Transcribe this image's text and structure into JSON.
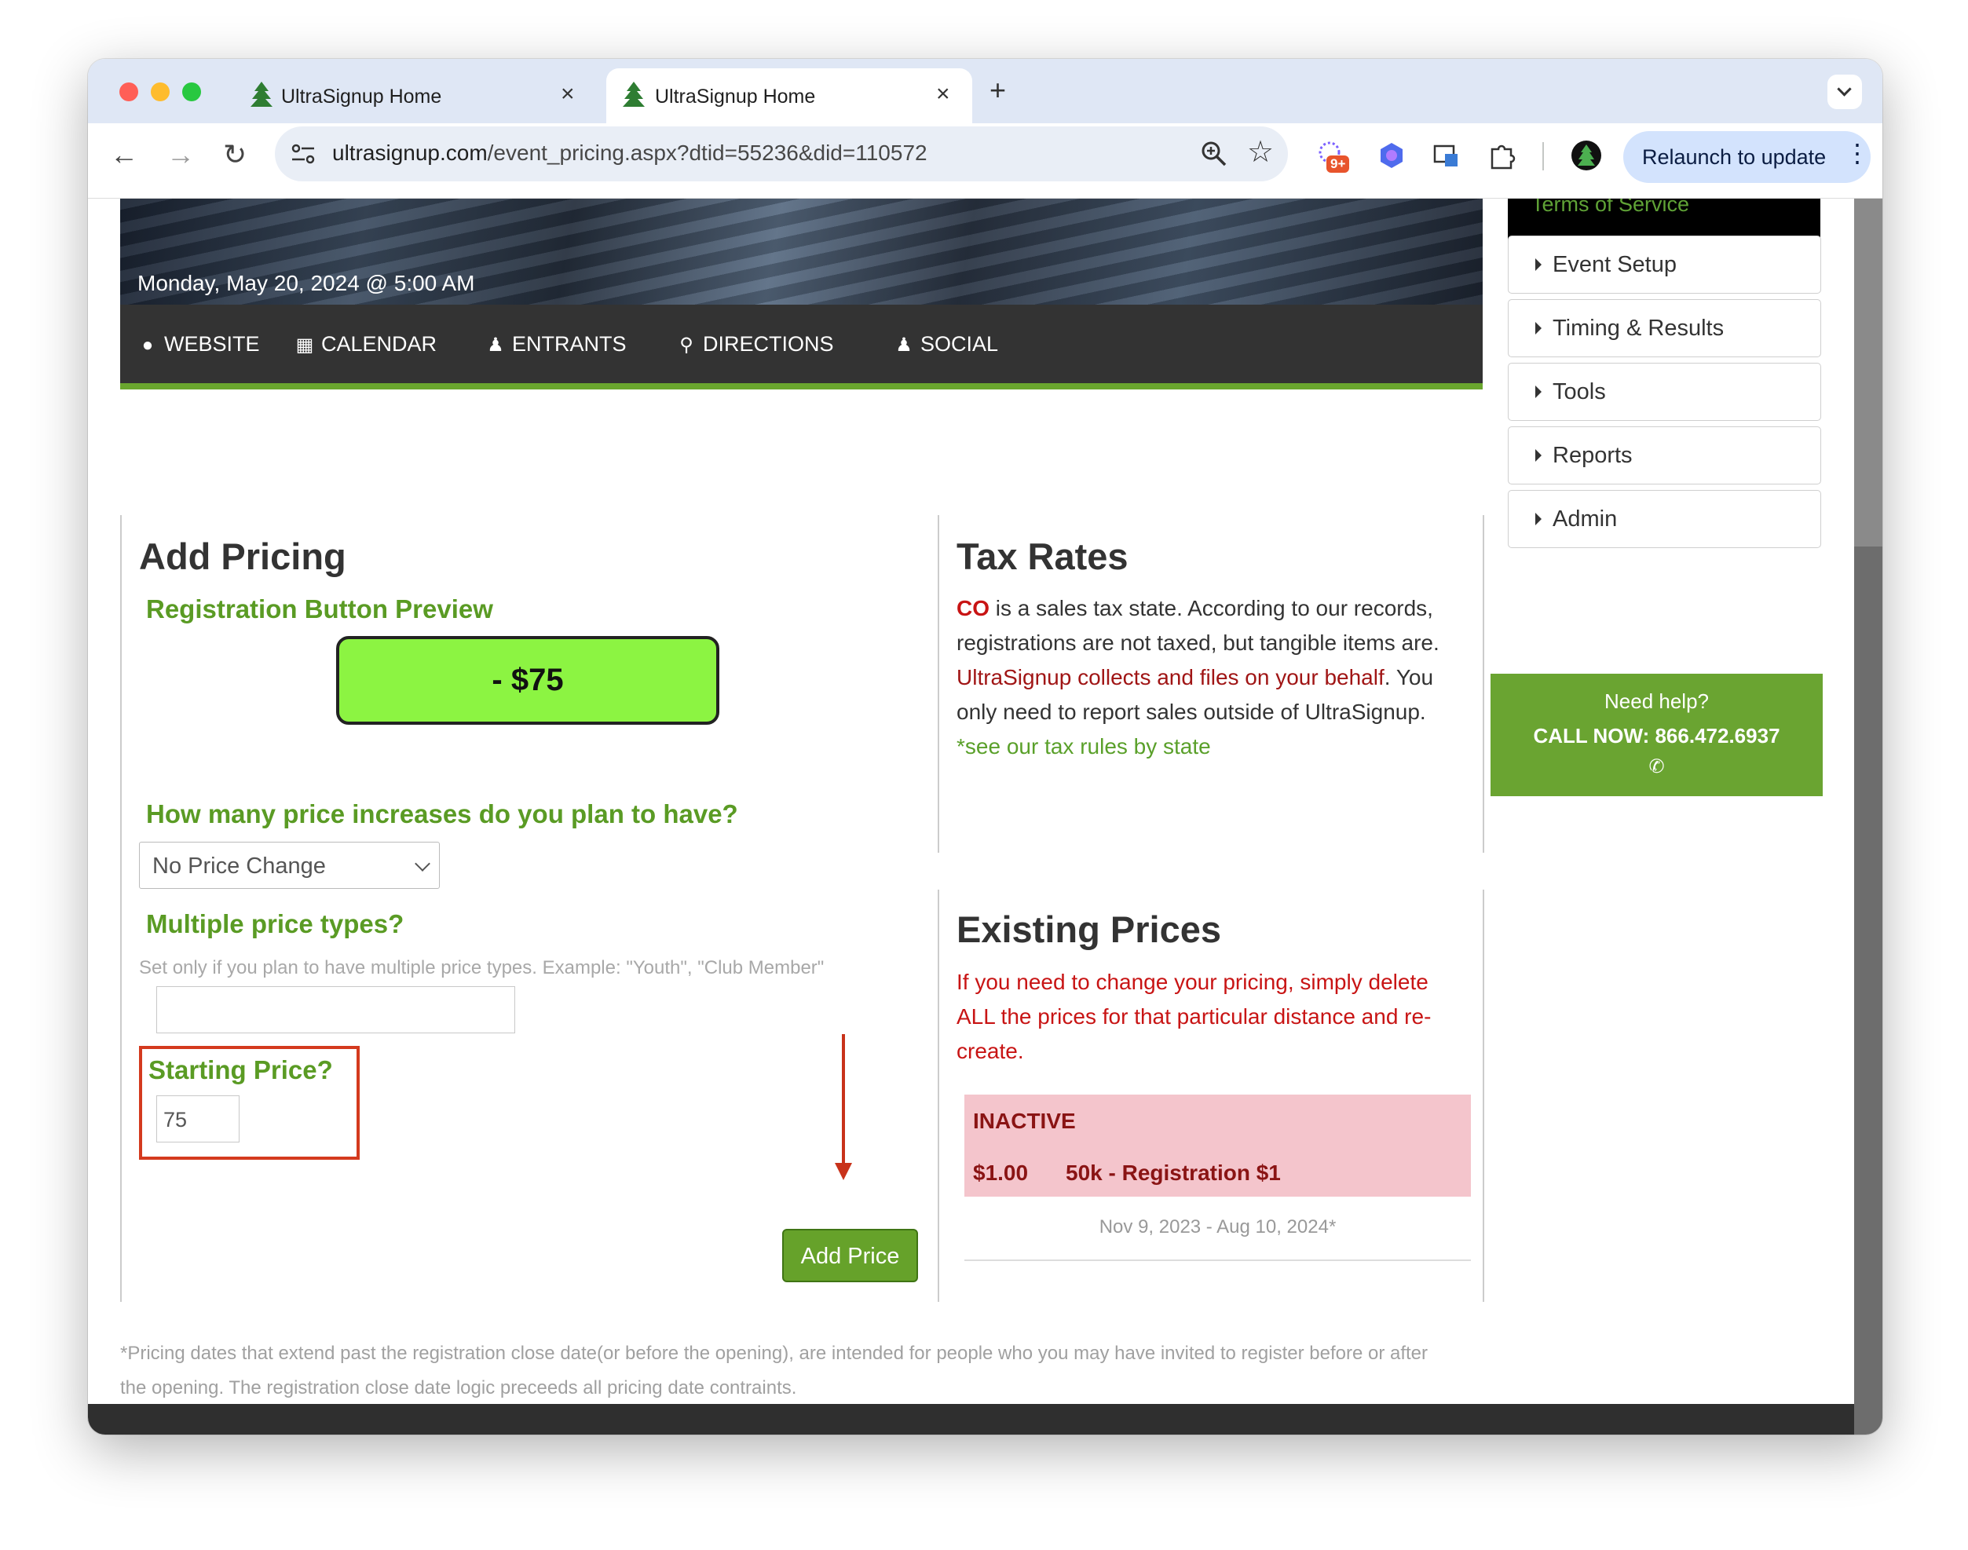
{
  "browser": {
    "tabs": [
      {
        "title": "UltraSignup Home",
        "active": false
      },
      {
        "title": "UltraSignup Home",
        "active": true
      }
    ],
    "url_host": "ultrasignup.com",
    "url_path": "/event_pricing.aspx?dtid=55236&did=110572",
    "extension_badge": "9+",
    "relaunch_label": "Relaunch to update"
  },
  "event": {
    "date": "Monday, May 20, 2024 @ 5:00 AM",
    "nav": [
      "WEBSITE",
      "CALENDAR",
      "ENTRANTS",
      "DIRECTIONS",
      "SOCIAL"
    ]
  },
  "sidebar": {
    "tos": "Terms of Service",
    "items": [
      "Event Setup",
      "Timing & Results",
      "Tools",
      "Reports",
      "Admin"
    ],
    "help": {
      "line1": "Need help?",
      "line2": "CALL NOW: 866.472.6937"
    }
  },
  "add_pricing": {
    "title": "Add Pricing",
    "preview_heading": "Registration Button Preview",
    "preview_button": "- $75",
    "increases_question": "How many price increases do you plan to have?",
    "increases_selected": "No Price Change",
    "types_question": "Multiple price types?",
    "types_hint": "Set only if you plan to have multiple price types. Example: \"Youth\", \"Club Member\"",
    "types_value": "",
    "starting_label": "Starting Price?",
    "starting_value": "75",
    "add_button": "Add Price"
  },
  "tax": {
    "title": "Tax Rates",
    "state": "CO",
    "line1_rest": " is a sales tax state. According to our records,",
    "line2": "registrations are not taxed, but tangible items are.",
    "line3_red": "UltraSignup collects and files on your behalf",
    "line3_rest": ". You",
    "line4": "only need to report sales outside of UltraSignup.",
    "link": "*see our tax rules by state"
  },
  "existing": {
    "title": "Existing Prices",
    "notice": [
      "If you need to change your pricing, simply delete",
      "ALL the prices for that particular distance and re-",
      "create."
    ],
    "status": "INACTIVE",
    "amount": "$1.00",
    "name": "50k - Registration $1",
    "range": "Nov 9, 2023 - Aug 10, 2024*"
  },
  "footnote": [
    "*Pricing dates that extend past the registration close date(or before the opening), are intended for people who you may have invited to register before or after",
    "the opening. The registration close date logic preceeds all pricing date contraints."
  ],
  "colors": {
    "accent_green": "#5a9b24",
    "preview_button": "#8cf442",
    "alert_red": "#c81414",
    "inactive_bg": "#f4c5cc"
  }
}
